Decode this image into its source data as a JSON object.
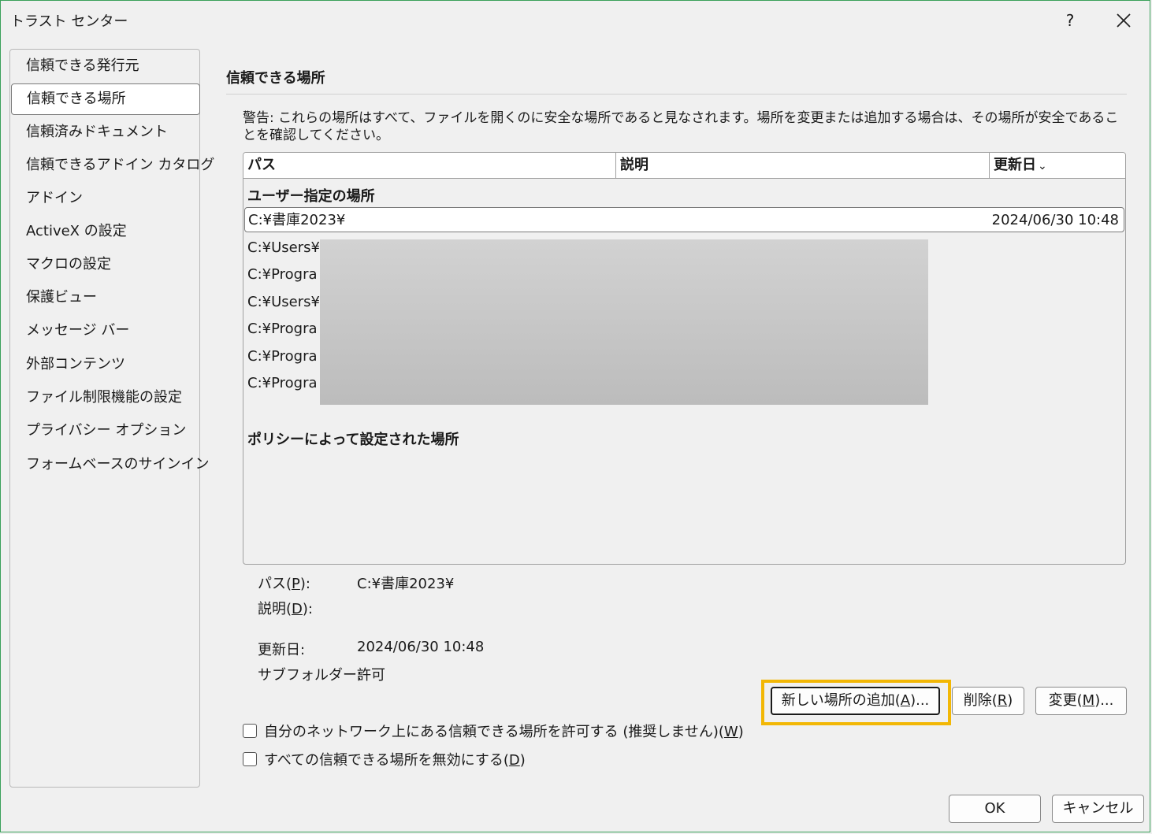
{
  "window": {
    "title": "トラスト センター",
    "help_label": "?"
  },
  "sidebar": {
    "items": [
      {
        "label": "信頼できる発行元"
      },
      {
        "label": "信頼できる場所",
        "selected": true
      },
      {
        "label": "信頼済みドキュメント"
      },
      {
        "label": "信頼できるアドイン カタログ"
      },
      {
        "label": "アドイン"
      },
      {
        "label": "ActiveX の設定"
      },
      {
        "label": "マクロの設定"
      },
      {
        "label": "保護ビュー"
      },
      {
        "label": "メッセージ バー"
      },
      {
        "label": "外部コンテンツ"
      },
      {
        "label": "ファイル制限機能の設定"
      },
      {
        "label": "プライバシー オプション"
      },
      {
        "label": "フォームベースのサインイン"
      }
    ]
  },
  "main": {
    "title": "信頼できる場所",
    "warning": "警告: これらの場所はすべて、ファイルを開くのに安全な場所であると見なされます。場所を変更または追加する場合は、その場所が安全であることを確認してください。",
    "columns": {
      "path": "パス",
      "description": "説明",
      "updated": "更新日"
    },
    "user_group": "ユーザー指定の場所",
    "policy_group": "ポリシーによって設定された場所",
    "rows": [
      {
        "path": "C:¥書庫2023¥",
        "updated": "2024/06/30 10:48",
        "selected": true
      },
      {
        "path": "C:¥Users¥"
      },
      {
        "path": "C:¥Progra"
      },
      {
        "path": "C:¥Users¥"
      },
      {
        "path": "C:¥Progra"
      },
      {
        "path": "C:¥Progra"
      },
      {
        "path": "C:¥Progra"
      }
    ],
    "details": {
      "path_label_pre": "パス(",
      "path_label_key": "P",
      "path_label_post": "):",
      "path_value": "C:¥書庫2023¥",
      "desc_label_pre": "説明(",
      "desc_label_key": "D",
      "desc_label_post": "):",
      "updated_label": "更新日:",
      "updated_value": "2024/06/30 10:48",
      "subfolder_label": "サブフォルダー:",
      "subfolder_value": "許可"
    },
    "buttons": {
      "add_pre": "新しい場所の追加(",
      "add_key": "A",
      "add_post": ")...",
      "remove_pre": "削除(",
      "remove_key": "R",
      "remove_post": ")",
      "modify_pre": "変更(",
      "modify_key": "M",
      "modify_post": ")..."
    },
    "checkboxes": {
      "network_pre": "自分のネットワーク上にある信頼できる場所を許可する (推奨しません)(",
      "network_key": "W",
      "network_post": ")",
      "disable_pre": "すべての信頼できる場所を無効にする(",
      "disable_key": "D",
      "disable_post": ")"
    }
  },
  "footer": {
    "ok_label": "OK",
    "cancel_label": "キャンセル"
  },
  "colors": {
    "focus_highlight": "#f2b705",
    "window_border": "#3aa05a"
  }
}
